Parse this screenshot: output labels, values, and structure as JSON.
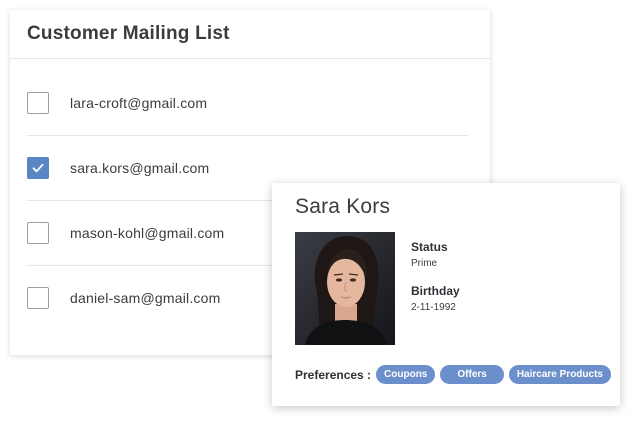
{
  "mailing_list": {
    "title": "Customer Mailing List",
    "customers": [
      {
        "email": "lara-croft@gmail.com",
        "checked": false
      },
      {
        "email": "sara.kors@gmail.com",
        "checked": true
      },
      {
        "email": "mason-kohl@gmail.com",
        "checked": false
      },
      {
        "email": "daniel-sam@gmail.com",
        "checked": false
      }
    ]
  },
  "profile": {
    "name": "Sara Kors",
    "status_label": "Status",
    "status_value": "Prime",
    "birthday_label": "Birthday",
    "birthday_value": "2-11-1992",
    "preferences_label": "Preferences :",
    "preferences": [
      "Coupons",
      "Offers",
      "Haircare Products"
    ]
  },
  "colors": {
    "accent": "#5b86c5",
    "tag": "#6b8fcb"
  }
}
